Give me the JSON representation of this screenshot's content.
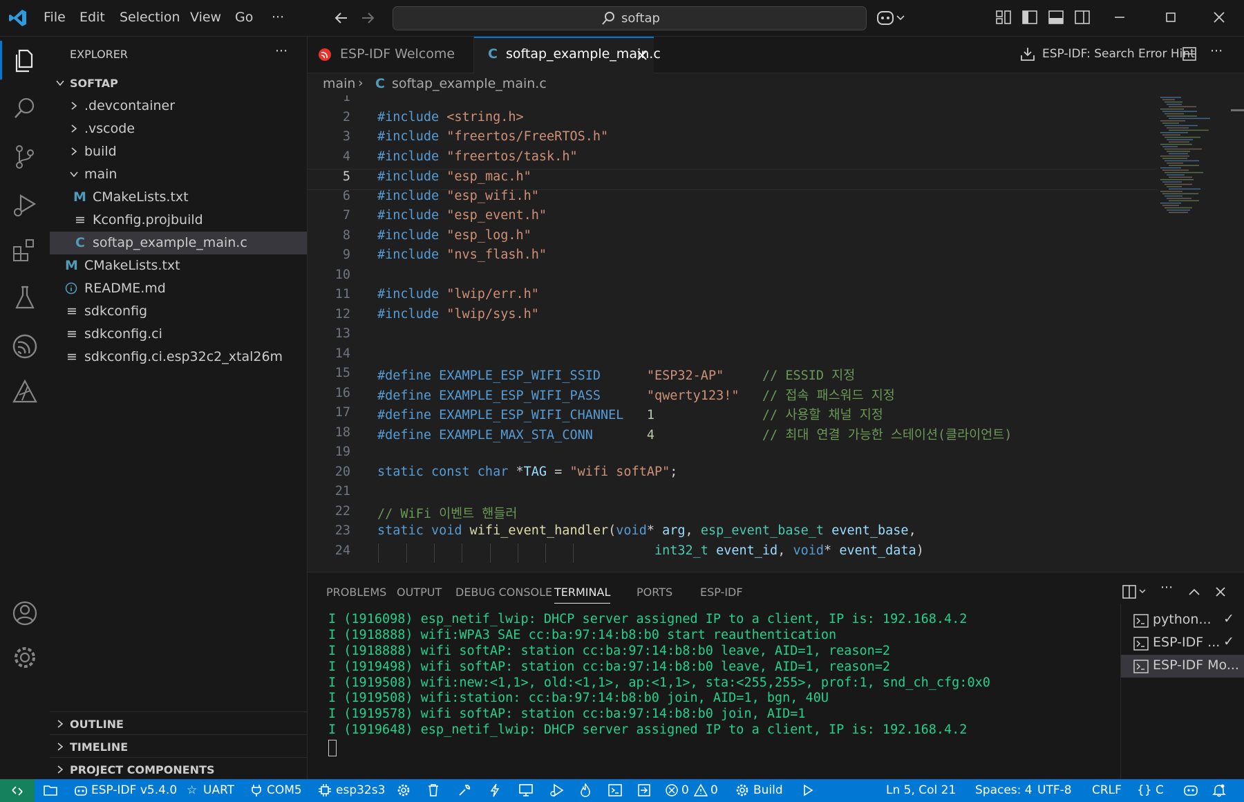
{
  "menu": [
    "File",
    "Edit",
    "Selection",
    "View",
    "Go",
    "···"
  ],
  "search": {
    "text": "softap"
  },
  "explorer": {
    "title": "EXPLORER",
    "more": "···",
    "root": "SOFTAP",
    "items": [
      {
        "label": ".devcontainer"
      },
      {
        "label": ".vscode"
      },
      {
        "label": "build"
      },
      {
        "label": "main"
      },
      {
        "label": "CMakeLists.txt",
        "badge": "M"
      },
      {
        "label": "Kconfig.projbuild"
      },
      {
        "label": "softap_example_main.c",
        "badge": "C"
      },
      {
        "label": "CMakeLists.txt",
        "badge": "M"
      },
      {
        "label": "README.md"
      },
      {
        "label": "sdkconfig"
      },
      {
        "label": "sdkconfig.ci"
      },
      {
        "label": "sdkconfig.ci.esp32c2_xtal26m"
      }
    ],
    "sections": [
      "OUTLINE",
      "TIMELINE",
      "PROJECT COMPONENTS"
    ]
  },
  "tabs": [
    {
      "label": "ESP-IDF Welcome"
    },
    {
      "label": "softap_example_main.c",
      "badge": "C"
    }
  ],
  "tab_actions": {
    "search_error_hint": "ESP-IDF: Search Error Hint",
    "more": "···"
  },
  "breadcrumb": {
    "folder": "main",
    "file": "softap_example_main.c",
    "badge": "C"
  },
  "editor": {
    "current_line": 5,
    "lines": [
      {
        "n": "1",
        "tokens": []
      },
      {
        "n": "2",
        "tokens": [
          [
            "pp",
            "#include "
          ],
          [
            "str",
            "<string.h>"
          ]
        ]
      },
      {
        "n": "3",
        "tokens": [
          [
            "pp",
            "#include "
          ],
          [
            "str",
            "\"freertos/FreeRTOS.h\""
          ]
        ]
      },
      {
        "n": "4",
        "tokens": [
          [
            "pp",
            "#include "
          ],
          [
            "str",
            "\"freertos/task.h\""
          ]
        ]
      },
      {
        "n": "5",
        "tokens": [
          [
            "pp",
            "#include "
          ],
          [
            "str",
            "\"esp_mac.h\""
          ]
        ]
      },
      {
        "n": "6",
        "tokens": [
          [
            "pp",
            "#include "
          ],
          [
            "str",
            "\"esp_wifi.h\""
          ]
        ]
      },
      {
        "n": "7",
        "tokens": [
          [
            "pp",
            "#include "
          ],
          [
            "str",
            "\"esp_event.h\""
          ]
        ]
      },
      {
        "n": "8",
        "tokens": [
          [
            "pp",
            "#include "
          ],
          [
            "str",
            "\"esp_log.h\""
          ]
        ]
      },
      {
        "n": "9",
        "tokens": [
          [
            "pp",
            "#include "
          ],
          [
            "str",
            "\"nvs_flash.h\""
          ]
        ]
      },
      {
        "n": "10",
        "tokens": []
      },
      {
        "n": "11",
        "tokens": [
          [
            "pp",
            "#include "
          ],
          [
            "str",
            "\"lwip/err.h\""
          ]
        ]
      },
      {
        "n": "12",
        "tokens": [
          [
            "pp",
            "#include "
          ],
          [
            "str",
            "\"lwip/sys.h\""
          ]
        ]
      },
      {
        "n": "13",
        "tokens": []
      },
      {
        "n": "14",
        "tokens": []
      },
      {
        "n": "15",
        "tokens": [
          [
            "pp",
            "#define "
          ],
          [
            "mac",
            "EXAMPLE_ESP_WIFI_SSID      "
          ],
          [
            "str",
            "\"ESP32-AP\""
          ],
          [
            "pl",
            "     "
          ],
          [
            "cmt",
            "// ESSID 지정"
          ]
        ]
      },
      {
        "n": "16",
        "tokens": [
          [
            "pp",
            "#define "
          ],
          [
            "mac",
            "EXAMPLE_ESP_WIFI_PASS      "
          ],
          [
            "str",
            "\"qwerty123!\""
          ],
          [
            "pl",
            "   "
          ],
          [
            "cmt",
            "// 접속 패스워드 지정"
          ]
        ]
      },
      {
        "n": "17",
        "tokens": [
          [
            "pp",
            "#define "
          ],
          [
            "mac",
            "EXAMPLE_ESP_WIFI_CHANNEL   "
          ],
          [
            "num",
            "1"
          ],
          [
            "pl",
            "              "
          ],
          [
            "cmt",
            "// 사용할 채널 지정"
          ]
        ]
      },
      {
        "n": "18",
        "tokens": [
          [
            "pp",
            "#define "
          ],
          [
            "mac",
            "EXAMPLE_MAX_STA_CONN       "
          ],
          [
            "num",
            "4"
          ],
          [
            "pl",
            "              "
          ],
          [
            "cmt",
            "// 최대 연결 가능한 스테이션(클라이언트)"
          ]
        ]
      },
      {
        "n": "19",
        "tokens": []
      },
      {
        "n": "20",
        "tokens": [
          [
            "kw",
            "static const char "
          ],
          [
            "pl",
            "*"
          ],
          [
            "id",
            "TAG"
          ],
          [
            "pl",
            " = "
          ],
          [
            "str",
            "\"wifi softAP\""
          ],
          [
            "pl",
            ";"
          ]
        ]
      },
      {
        "n": "21",
        "tokens": []
      },
      {
        "n": "22",
        "tokens": [
          [
            "cmt",
            "// WiFi 이벤트 핸들러"
          ]
        ]
      },
      {
        "n": "23",
        "tokens": [
          [
            "kw",
            "static void "
          ],
          [
            "fn",
            "wifi_event_handler"
          ],
          [
            "pl",
            "("
          ],
          [
            "kw",
            "void"
          ],
          [
            "pl",
            "* "
          ],
          [
            "id",
            "arg"
          ],
          [
            "pl",
            ", "
          ],
          [
            "ty",
            "esp_event_base_t"
          ],
          [
            "pl",
            " "
          ],
          [
            "id",
            "event_base"
          ],
          [
            "pl",
            ","
          ]
        ]
      },
      {
        "n": "24",
        "tokens": [
          [
            "pl",
            "                                    "
          ],
          [
            "ty",
            "int32_t"
          ],
          [
            "pl",
            " "
          ],
          [
            "id",
            "event_id"
          ],
          [
            "pl",
            ", "
          ],
          [
            "kw",
            "void"
          ],
          [
            "pl",
            "* "
          ],
          [
            "id",
            "event_data"
          ],
          [
            "pl",
            ")"
          ]
        ]
      }
    ]
  },
  "panel": {
    "tabs": [
      "PROBLEMS",
      "OUTPUT",
      "DEBUG CONSOLE",
      "TERMINAL",
      "PORTS",
      "ESP-IDF"
    ],
    "active_tab": "TERMINAL",
    "terminal_lines": [
      "I (1916098) esp_netif_lwip: DHCP server assigned IP to a client, IP is: 192.168.4.2",
      "I (1918888) wifi:WPA3 SAE cc:ba:97:14:b8:b0 start reauthentication",
      "I (1918888) wifi softAP: station cc:ba:97:14:b8:b0 leave, AID=1, reason=2",
      "I (1919498) wifi softAP: station cc:ba:97:14:b8:b0 leave, AID=1, reason=2",
      "I (1919508) wifi:new:<1,1>, old:<1,1>, ap:<1,1>, sta:<255,255>, prof:1, snd_ch_cfg:0x0",
      "I (1919508) wifi:station: cc:ba:97:14:b8:b0 join, AID=1, bgn, 40U",
      "I (1919578) wifi softAP: station cc:ba:97:14:b8:b0 join, AID=1",
      "I (1919648) esp_netif_lwip: DHCP server assigned IP to a client, IP is: 192.168.4.2"
    ],
    "terminals": [
      {
        "label": "python...",
        "check": "✓"
      },
      {
        "label": "ESP-IDF ...",
        "check": "✓"
      },
      {
        "label": "ESP-IDF Mo...",
        "check": ""
      }
    ]
  },
  "status": {
    "idf_version": "ESP-IDF v5.4.0",
    "flash_method": "UART",
    "port": "COM5",
    "target": "esp32s3",
    "errors": "0",
    "warnings": "0",
    "build": "Build",
    "cursor": "Ln 5, Col 21",
    "spaces": "Spaces: 4",
    "encoding": "UTF-8",
    "eol": "CRLF",
    "language": "C",
    "language_braces": "{}"
  },
  "colors": {
    "accent": "#0078d4",
    "terminal_text": "#23d18b",
    "tree_badge_m": "#519aba",
    "tree_badge_c": "#519aba"
  }
}
